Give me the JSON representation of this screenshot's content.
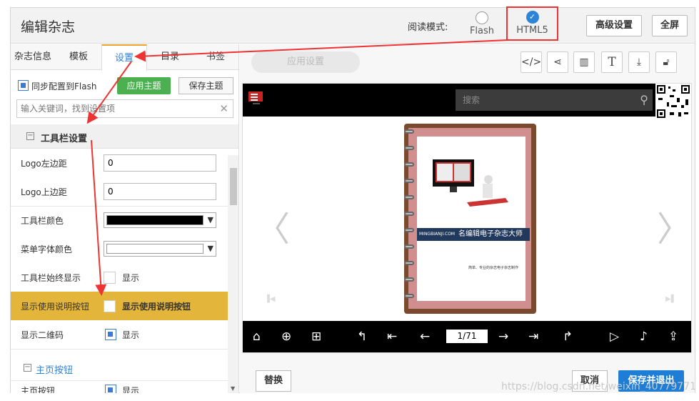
{
  "header": {
    "title": "编辑杂志",
    "read_mode_label": "阅读模式:",
    "mode_flash": "Flash",
    "mode_html5": "HTML5",
    "advanced_btn": "高级设置",
    "fullscreen_btn": "全屏"
  },
  "tabs": [
    "杂志信息",
    "模板",
    "设置",
    "目录",
    "书签"
  ],
  "settings": {
    "sync_flash": "同步配置到Flash",
    "apply_theme": "应用主题",
    "save_theme": "保存主题",
    "search_placeholder": "输入关键词，找到设置项",
    "section_toolbar": "工具栏设置",
    "logo_left_label": "Logo左边距",
    "logo_left_value": "0",
    "logo_top_label": "Logo上边距",
    "logo_top_value": "0",
    "toolbar_color_label": "工具栏颜色",
    "toolbar_color": "#000000",
    "menu_font_color_label": "菜单字体颜色",
    "menu_font_color": "#ffffff",
    "toolbar_always_label": "工具栏始终显示",
    "toolbar_always_value": "显示",
    "show_help_label": "显示使用说明按钮",
    "show_help_value": "显示使用说明按钮",
    "show_qr_label": "显示二维码",
    "show_qr_value": "显示",
    "section_home": "主页按钮",
    "home_btn_label": "主页按钮",
    "home_btn_value": "显示"
  },
  "right": {
    "app_settings": "应用设置",
    "icons": [
      "code-icon",
      "share-icon",
      "columns-icon",
      "text-icon",
      "download-icon",
      "unlock-icon"
    ],
    "search_placeholder": "搜索",
    "book_banner": "名编辑电子杂志大师",
    "book_banner_small": "MINGBIANJI.COM",
    "book_tiny_text": "简单、专业的杂志电子杂志制作",
    "page_no": "1/71",
    "replace_btn": "替换",
    "cancel_btn": "取消",
    "save_exit_btn": "保存并退出"
  },
  "watermark": "https://blog.csdn.net/weixin_40779771"
}
